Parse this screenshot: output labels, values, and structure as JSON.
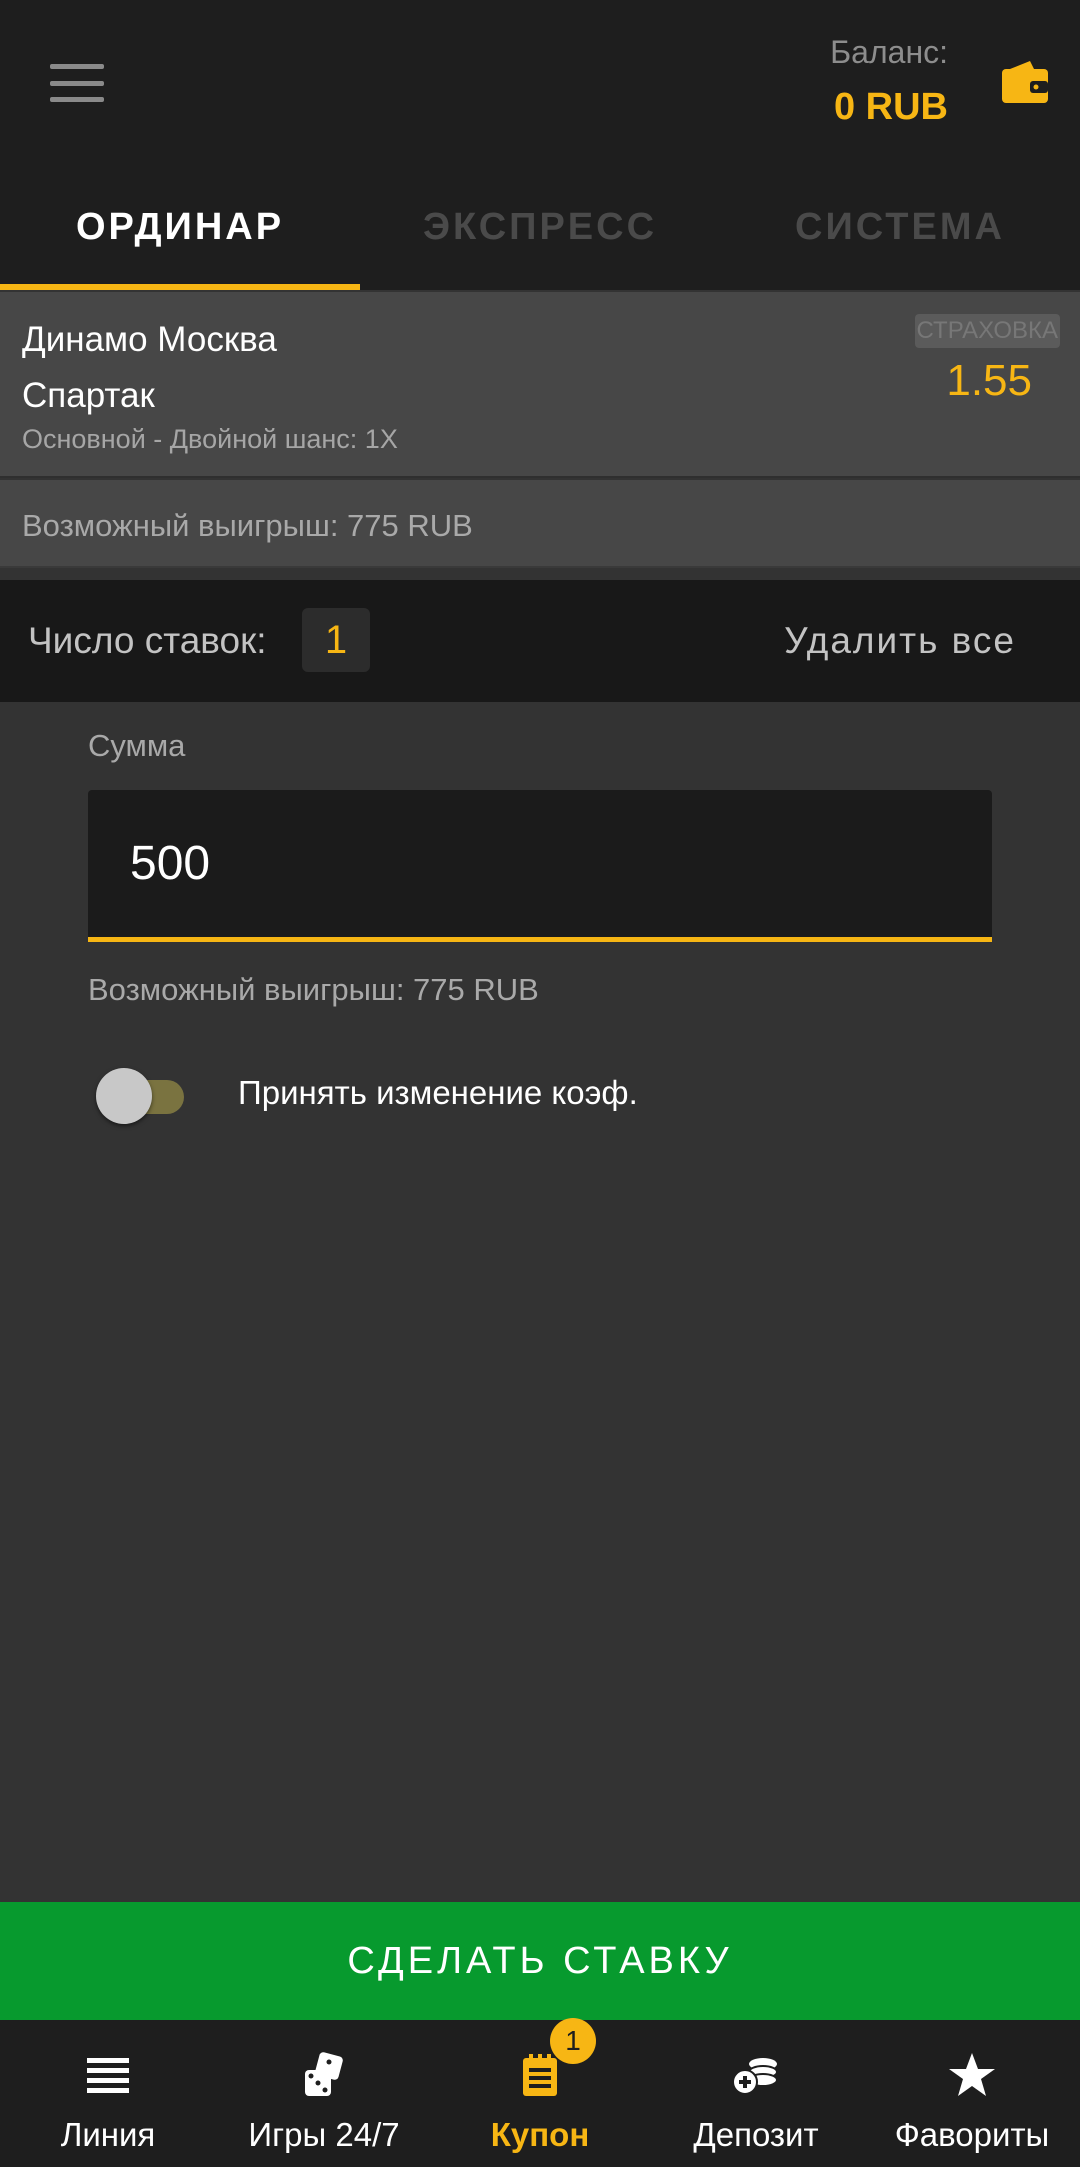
{
  "header": {
    "balance_label": "Баланс:",
    "balance_value": "0 RUB",
    "menu_icon": "hamburger-menu-icon",
    "wallet_icon": "wallet-icon"
  },
  "tabs": [
    {
      "label": "ОРДИНАР",
      "active": true
    },
    {
      "label": "ЭКСПРЕСС",
      "active": false
    },
    {
      "label": "СИСТЕМА",
      "active": false
    }
  ],
  "bet": {
    "team1": "Динамо Москва",
    "team2": "Спартак",
    "market": "Основной - Двойной шанс: 1X",
    "insurance": "СТРАХОВКА",
    "odds": "1.55",
    "possible_win": "Возможный выигрыш: 775 RUB"
  },
  "count_bar": {
    "label": "Число ставок:",
    "count": "1",
    "delete_all": "Удалить все"
  },
  "amount": {
    "label": "Сумма",
    "value": "500",
    "possible_win": "Возможный выигрыш: 775 RUB"
  },
  "accept_changes": {
    "label": "Принять изменение коэф.",
    "enabled": false
  },
  "make_bet_label": "СДЕЛАТЬ СТАВКУ",
  "bottom_nav": [
    {
      "label": "Линия",
      "icon": "list-icon"
    },
    {
      "label": "Игры 24/7",
      "icon": "dice-icon"
    },
    {
      "label": "Купон",
      "icon": "coupon-icon",
      "active": true,
      "badge": "1"
    },
    {
      "label": "Депозит",
      "icon": "coins-plus-icon"
    },
    {
      "label": "Фавориты",
      "icon": "star-icon"
    }
  ],
  "colors": {
    "accent": "#f7b614",
    "primary_button": "#079a2e",
    "background": "#333333",
    "header": "#1e1e1e"
  }
}
